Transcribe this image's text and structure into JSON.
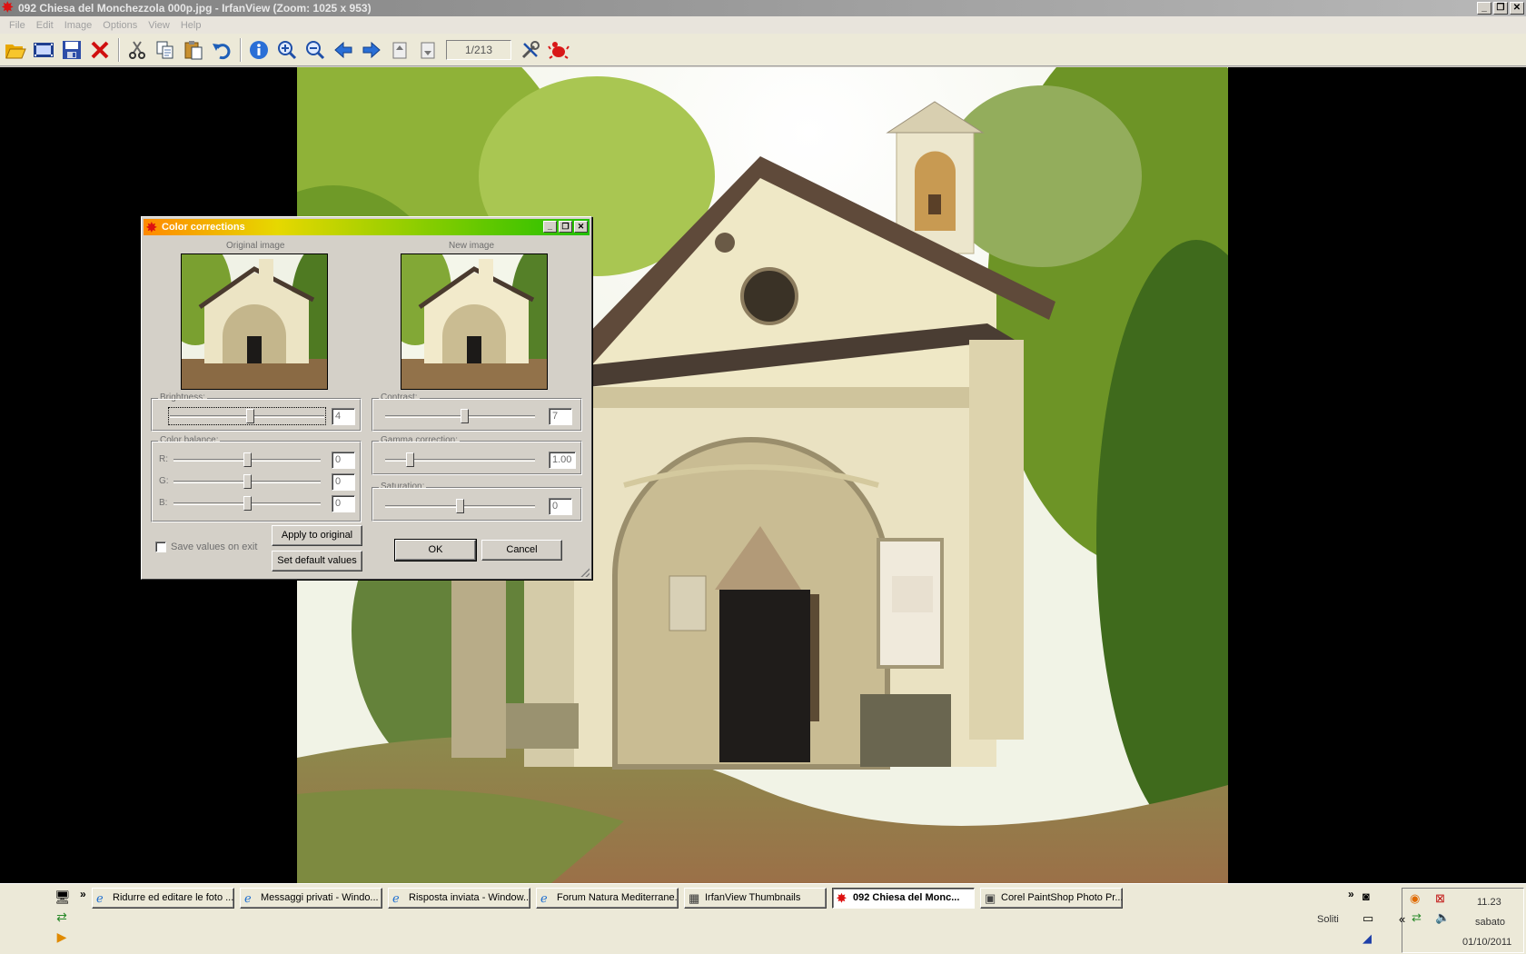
{
  "window": {
    "title": "092 Chiesa del Monchezzola 000p.jpg - IrfanView (Zoom: 1025 x 953)",
    "controls": [
      "_",
      "❐",
      "✕"
    ]
  },
  "menu": [
    "File",
    "Edit",
    "Image",
    "Options",
    "View",
    "Help"
  ],
  "toolbar": {
    "page_counter": "1/213",
    "icons": [
      "open-folder-icon",
      "slideshow-icon",
      "save-icon",
      "delete-icon",
      "cut-icon",
      "copy-icon",
      "paste-icon",
      "undo-icon",
      "info-icon",
      "zoom-in-icon",
      "zoom-out-icon",
      "previous-icon",
      "next-icon",
      "first-page-icon",
      "last-page-icon",
      "settings-icon",
      "irfanview-logo-icon"
    ]
  },
  "dialog": {
    "title": "Color corrections",
    "original_label": "Original image",
    "new_label": "New image",
    "brightness": {
      "label": "Brightness:",
      "value": "4",
      "level": 0.52
    },
    "contrast": {
      "label": "Contrast:",
      "value": "7",
      "level": 0.53
    },
    "color_balance": {
      "label": "Color balance:",
      "channels": [
        {
          "label": "R:",
          "value": "0",
          "level": 0.5
        },
        {
          "label": "G:",
          "value": "0",
          "level": 0.5
        },
        {
          "label": "B:",
          "value": "0",
          "level": 0.5
        }
      ]
    },
    "gamma": {
      "label": "Gamma correction:",
      "value": "1.00",
      "level": 0.15
    },
    "saturation": {
      "label": "Saturation:",
      "value": "0",
      "level": 0.5
    },
    "save_values_label": "Save values on exit",
    "save_values_checked": false,
    "apply_label": "Apply to original",
    "default_label": "Set default values",
    "ok_label": "OK",
    "cancel_label": "Cancel"
  },
  "taskbar": {
    "tasks": [
      {
        "label": "Ridurre ed editare le foto ...",
        "icon": "ie-icon",
        "active": false
      },
      {
        "label": "Messaggi privati - Windo...",
        "icon": "ie-icon",
        "active": false
      },
      {
        "label": "Risposta inviata - Window...",
        "icon": "ie-icon",
        "active": false
      },
      {
        "label": "Forum Natura Mediterrane...",
        "icon": "ie-icon",
        "active": false
      },
      {
        "label": "IrfanView Thumbnails",
        "icon": "thumbnails-icon",
        "active": false
      },
      {
        "label": "092 Chiesa del Monc...",
        "icon": "irfanview-icon",
        "active": true
      },
      {
        "label": "Corel PaintShop Photo Pr...",
        "icon": "paintshop-icon",
        "active": false
      }
    ],
    "toolbar_label": "Soliti",
    "clock": {
      "time": "11.23",
      "day": "sabato",
      "date": "01/10/2011"
    }
  },
  "colors": {
    "dialog_title_gradient": [
      "#ff8a00",
      "#e6d800",
      "#20c000"
    ],
    "viewer_background": "#000000"
  }
}
